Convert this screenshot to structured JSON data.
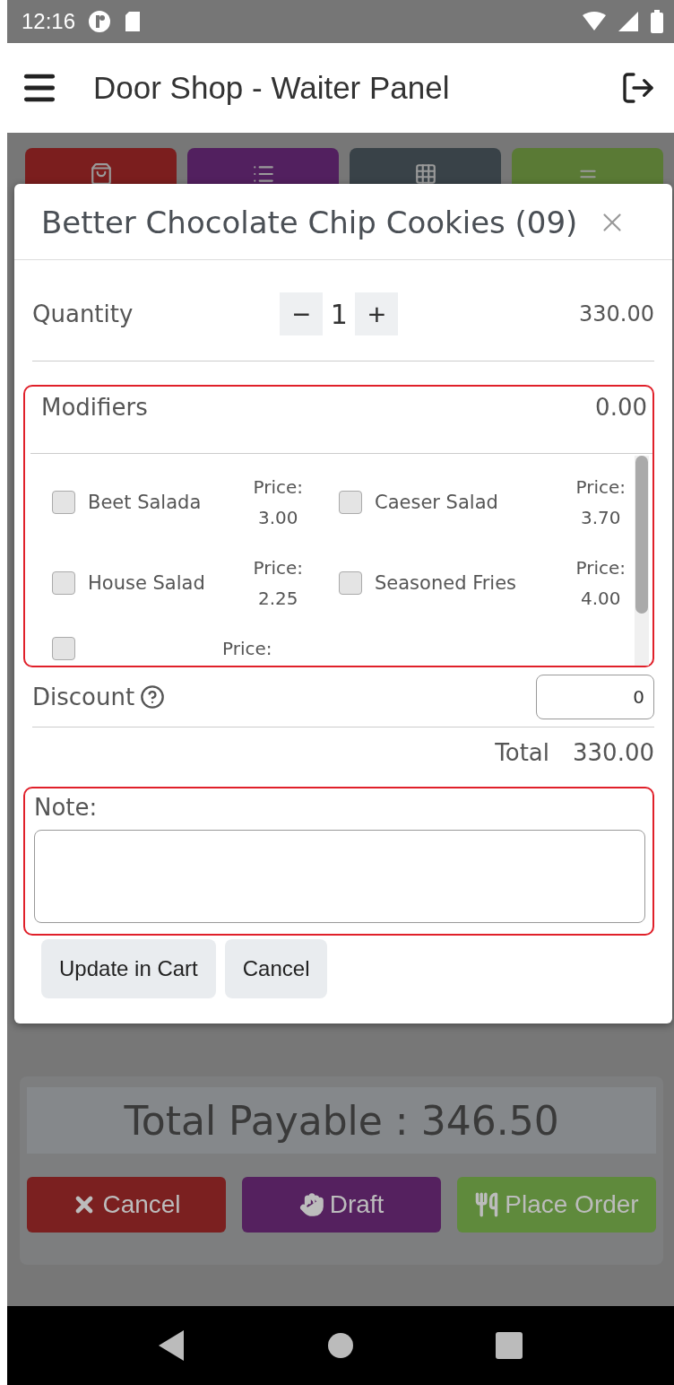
{
  "status_bar": {
    "time": "12:16"
  },
  "app_bar": {
    "title": "Door Shop - Waiter Panel"
  },
  "tiles": [
    {
      "kind": "bag",
      "color": "#7b1e1e"
    },
    {
      "kind": "list",
      "color": "#52205f"
    },
    {
      "kind": "grid",
      "color": "#394248"
    },
    {
      "kind": "lines",
      "color": "#5a7a35"
    }
  ],
  "modal": {
    "title": "Better Chocolate Chip Cookies (09)",
    "quantity": {
      "label": "Quantity",
      "minus": "−",
      "value": "1",
      "plus": "+",
      "amount": "330.00"
    },
    "modifiers": {
      "label": "Modifiers",
      "amount": "0.00",
      "items": [
        {
          "name": "Beet Salada",
          "price_label": "Price:",
          "price": "3.00",
          "checked": false
        },
        {
          "name": "Caeser Salad",
          "price_label": "Price:",
          "price": "3.70",
          "checked": false
        },
        {
          "name": "House Salad",
          "price_label": "Price:",
          "price": "2.25",
          "checked": false
        },
        {
          "name": "Seasoned Fries",
          "price_label": "Price:",
          "price": "4.00",
          "checked": false
        },
        {
          "price_label": "Price:",
          "checked": false
        }
      ]
    },
    "discount": {
      "label": "Discount",
      "value": "0"
    },
    "total": {
      "label": "Total",
      "amount": "330.00"
    },
    "note": {
      "label": "Note:"
    },
    "buttons": [
      "Update in Cart",
      "Cancel"
    ]
  },
  "summary": {
    "total_payable": "Total Payable : 346.50"
  },
  "actions": [
    {
      "kind": "cancel",
      "label": "Cancel",
      "color": "#7b2020"
    },
    {
      "kind": "draft",
      "label": "Draft",
      "color": "#55215f"
    },
    {
      "kind": "order",
      "label": "Place Order",
      "color": "#5f8a3c"
    }
  ]
}
